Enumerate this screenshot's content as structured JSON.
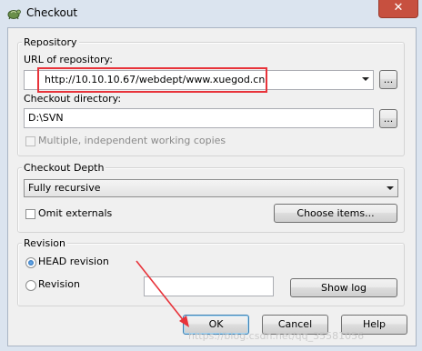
{
  "window": {
    "title": "Checkout",
    "close_glyph": "✕",
    "app_icon": "tortoise-svn-icon"
  },
  "repository": {
    "group_label": "Repository",
    "url_label": "URL of repository:",
    "url_value": "http://10.10.10.67/webdept/www.xuegod.cn",
    "url_browse": "...",
    "dir_label": "Checkout directory:",
    "dir_value": "D:\\SVN",
    "dir_browse": "...",
    "multiple_label": "Multiple, independent working copies",
    "multiple_checked": false
  },
  "depth": {
    "group_label": "Checkout Depth",
    "selected": "Fully recursive",
    "omit_label": "Omit externals",
    "omit_checked": false,
    "choose_items": "Choose items..."
  },
  "revision": {
    "group_label": "Revision",
    "head_label": "HEAD revision",
    "revision_label": "Revision",
    "selected": "HEAD revision",
    "revision_value": "",
    "show_log": "Show log"
  },
  "buttons": {
    "ok": "OK",
    "cancel": "Cancel",
    "help": "Help"
  },
  "annotation": {
    "color": "#e8333a"
  },
  "watermark": "https://blog.csdn.net/qq_35581056"
}
